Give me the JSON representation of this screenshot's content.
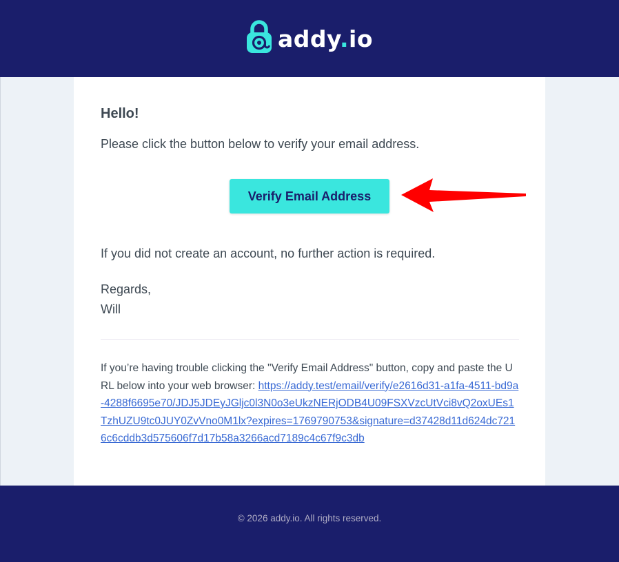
{
  "header": {
    "brand_name": "addy",
    "brand_dot": ".",
    "brand_tld": "io",
    "bg_color": "#1a1e6b",
    "accent_color": "#3ae6de",
    "logo_icon": "lock-at-icon"
  },
  "email": {
    "greeting": "Hello!",
    "intro": "Please click the button below to verify your email address.",
    "button_label": "Verify Email Address",
    "button_color": "#3ae6de",
    "no_action": "If you did not create an account, no further action is required.",
    "regards": "Regards,",
    "signature": "Will",
    "subcopy_text": "If you’re having trouble clicking the \"Verify Email Address\" button, copy and paste the URL below into your web browser: ",
    "verify_url": "https://addy.test/email/verify/e2616d31-a1fa-4511-bd9a-4288f6695e70/JDJ5JDEyJGljc0l3N0o3eUkzNERjODB4U09FSXVzcUtVci8vQ2oxUEs1TzhUZU9tc0JUY0ZvVno0M1lx?expires=1769790753&signature=d37428d11d624dc7216c6cddb3d575606f7d17b58a3266acd7189c4c67f9c3db"
  },
  "annotation": {
    "arrow_color": "#ff0000",
    "arrow_icon": "red-arrow-pointer"
  },
  "footer": {
    "copyright": "© 2026 addy.io. All rights reserved."
  }
}
